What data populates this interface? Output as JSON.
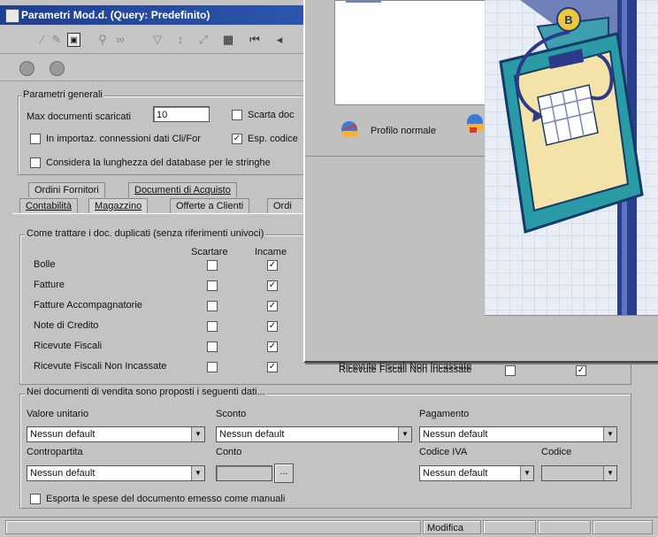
{
  "window": {
    "title": "Parametri Mod.d. (Query: Predefinito)"
  },
  "general": {
    "group_label": "Parametri generali",
    "max_docs_label": "Max documenti scaricati",
    "max_docs_value": "10",
    "scarta_label": "Scarta doc",
    "import_label": "In importaz. connessioni dati Cli/For",
    "esp_label": "Esp. codice",
    "length_label": "Considera la lunghezza del database per le stringhe"
  },
  "tabs_row1": [
    "Ordini Fornitori",
    "Documenti di Acquisto"
  ],
  "tabs_row2": [
    "Contabilità",
    "Magazzino",
    "Offerte a Clienti",
    "Ordi"
  ],
  "duplicates": {
    "group_label": "Come trattare i doc. duplicati (senza riferimenti univoci)",
    "col_scartare": "Scartare",
    "col_incame": "Incame",
    "rows": [
      {
        "label": "Bolle",
        "scartare": "",
        "incame": "✓"
      },
      {
        "label": "Fatture",
        "scartare": "",
        "incame": "✓"
      },
      {
        "label": "Fatture Accompagnatorie",
        "scartare": "",
        "incame": "✓"
      },
      {
        "label": "Note di Credito",
        "scartare": "",
        "incame": "✓"
      },
      {
        "label": "Ricevute Fiscali",
        "scartare": "",
        "incame": "✓"
      },
      {
        "label": "Ricevute Fiscali Non Incassate",
        "scartare": "",
        "incame": "✓"
      }
    ]
  },
  "sales": {
    "group_label": "Nei documenti di vendita sono proposti i seguenti dati...",
    "valore_label": "Valore unitario",
    "valore_value": "Nessun default",
    "sconto_label": "Sconto",
    "sconto_value": "Nessun default",
    "pagamento_label": "Pagamento",
    "pagamento_value": "Nessun default",
    "contropartita_label": "Contropartita",
    "contropartita_value": "Nessun default",
    "conto_label": "Conto",
    "conto_btn": "...",
    "codice_iva_label": "Codice IVA",
    "codice_iva_value": "Nessun default",
    "codice_label": "Codice",
    "esporta_label": "Esporta le spese del documento emesso come manuali"
  },
  "dialog": {
    "profile_label": "Profilo normale",
    "bg_row_label": "Ricevute Fiscali Non Incassate",
    "badge": "B"
  },
  "status": {
    "mode": "Modifica"
  },
  "colors": {
    "title_start": "#1f3f8f",
    "title_end": "#3b6fcf",
    "art_bg": "#e8edf6",
    "art_pole": "#2a3e8c",
    "clipboard": "#2a9aa5"
  }
}
